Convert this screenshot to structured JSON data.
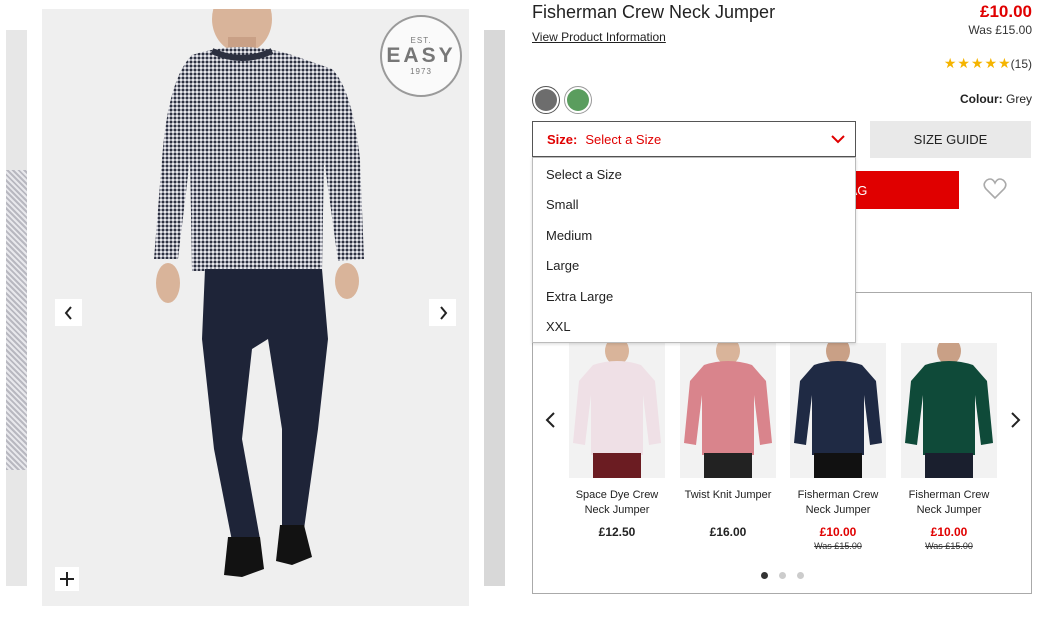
{
  "product": {
    "title": "Fisherman Crew Neck Jumper",
    "view_info": "View Product Information",
    "price": "£10.00",
    "was_price": "Was £15.00",
    "rating_stars": 5,
    "rating_count": "(15)",
    "colour_label": "Colour:",
    "colour_value": "Grey",
    "swatches": [
      {
        "name": "Grey",
        "color": "#6d6d6d",
        "selected": true
      },
      {
        "name": "Green",
        "color": "#5a9d5e",
        "selected": false
      }
    ]
  },
  "gallery": {
    "seal_top": "EST.",
    "seal_main": "EASY",
    "seal_year": "1973"
  },
  "size": {
    "label": "Size:",
    "value": "Select a Size",
    "guide": "SIZE GUIDE",
    "options": [
      "Select a Size",
      "Small",
      "Medium",
      "Large",
      "Extra Large",
      "XXL"
    ]
  },
  "bag": {
    "label": "AG"
  },
  "recommendations": {
    "items": [
      {
        "name": "Space Dye Crew Neck Jumper",
        "price": "£12.50",
        "sale": false,
        "was": "",
        "color": "#efe0e6"
      },
      {
        "name": "Twist Knit Jumper",
        "price": "£16.00",
        "sale": false,
        "was": "",
        "color": "#d9848c"
      },
      {
        "name": "Fisherman Crew Neck Jumper",
        "price": "£10.00",
        "sale": true,
        "was": "Was £15.00",
        "color": "#1f2a44"
      },
      {
        "name": "Fisherman Crew Neck Jumper",
        "price": "£10.00",
        "sale": true,
        "was": "Was £15.00",
        "color": "#0f4a39"
      }
    ],
    "page_count": 3,
    "active_page": 1
  },
  "colors": {
    "accent": "#e00000",
    "star": "#f5b400"
  }
}
